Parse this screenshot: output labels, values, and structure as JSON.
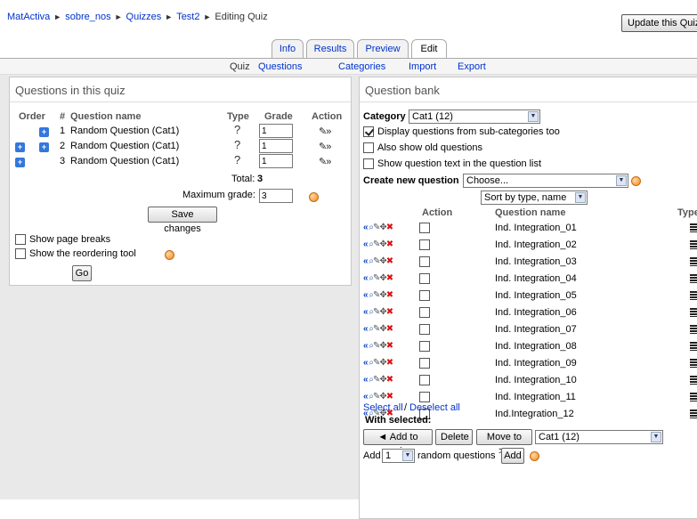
{
  "breadcrumb": {
    "items": [
      "MatActiva",
      "sobre_nos",
      "Quizzes",
      "Test2"
    ],
    "current": "Editing Quiz",
    "separator": "►"
  },
  "update_button": "Update this Quiz",
  "tabs": [
    "Info",
    "Results",
    "Preview",
    "Edit"
  ],
  "active_tab": "Edit",
  "subtabs": [
    "Quiz",
    "Questions",
    "Categories",
    "Import",
    "Export"
  ],
  "left": {
    "title": "Questions in this quiz",
    "headers": {
      "order": "Order",
      "num": "#",
      "name": "Question name",
      "type": "Type",
      "grade": "Grade",
      "action": "Action"
    },
    "questions": [
      {
        "num": "1",
        "name": "Random Question (Cat1)",
        "type_icon": "?",
        "grade": "1",
        "actions": "✎»"
      },
      {
        "num": "2",
        "name": "Random Question (Cat1)",
        "type_icon": "?",
        "grade": "1",
        "actions": "✎»"
      },
      {
        "num": "3",
        "name": "Random Question (Cat1)",
        "type_icon": "?",
        "grade": "1",
        "actions": "✎»"
      }
    ],
    "total_label": "Total:",
    "total_value": "3",
    "max_grade_label": "Maximum grade:",
    "max_grade_value": "3",
    "save_button": "Save changes",
    "show_page_breaks": "Show page breaks",
    "show_reordering": "Show the reordering tool",
    "go_button": "Go"
  },
  "right": {
    "title": "Question bank",
    "category_label": "Category",
    "category_value": "Cat1 (12)",
    "opt_subcats": "Display questions from sub-categories too",
    "opt_old": "Also show old questions",
    "opt_text": "Show question text in the question list",
    "create_label": "Create new question",
    "create_value": "Choose...",
    "sort_value": "Sort by type, name",
    "headers": {
      "action": "Action",
      "name": "Question name",
      "type": "Type"
    },
    "questions": [
      "Ind. Integration_01",
      "Ind. Integration_02",
      "Ind. Integration_03",
      "Ind. Integration_04",
      "Ind. Integration_05",
      "Ind. Integration_06",
      "Ind. Integration_07",
      "Ind. Integration_08",
      "Ind. Integration_09",
      "Ind. Integration_10",
      "Ind. Integration_11",
      "Ind.Integration_12"
    ],
    "select_all": "Select all",
    "slash": "/",
    "deselect_all": "Deselect all",
    "with_selected": "With selected:",
    "add_to_quiz": "◄ Add to quiz",
    "delete": "Delete",
    "move_to": "Move to >>",
    "move_target": "Cat1 (12)",
    "add_label": "Add",
    "add_count": "1",
    "random_label": "random questions",
    "add_button": "Add"
  }
}
